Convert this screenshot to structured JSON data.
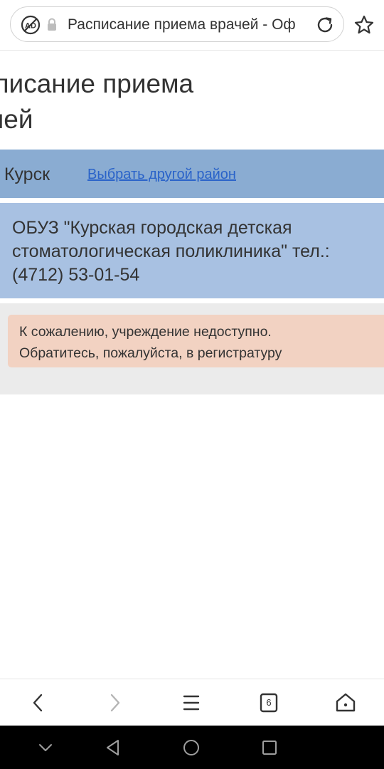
{
  "browser": {
    "url_title": "Расписание приема врачей - Оф",
    "tab_count": "6"
  },
  "page": {
    "title_line1": "списание приема",
    "title_line2": "чей",
    "region": {
      "name": ". Курск",
      "change_link": "Выбрать другой район"
    },
    "clinic": {
      "name": "ОБУЗ \"Курская городская детская стоматологическая поликлиника\" тел.: (4712) 53-01-54"
    },
    "alert": {
      "line1": "К сожалению, учреждение недоступно.",
      "line2": "Обратитесь, пожалуйста, в регистратуру"
    }
  },
  "colors": {
    "region_bar": "#8aacd2",
    "clinic_box": "#a8c1e2",
    "notice_area": "#ebebeb",
    "alert_box": "#f2d2c2",
    "link": "#2a63c9"
  },
  "icons": {
    "top": [
      "adblock-icon",
      "lock-icon",
      "reload-icon",
      "star-icon"
    ],
    "bottom_nav": [
      "back-arrow-icon",
      "forward-arrow-icon",
      "menu-icon",
      "tabs-icon",
      "home-icon"
    ],
    "system_nav": [
      "collapse-chevron-icon",
      "system-back-icon",
      "system-home-icon",
      "system-recent-icon"
    ]
  }
}
